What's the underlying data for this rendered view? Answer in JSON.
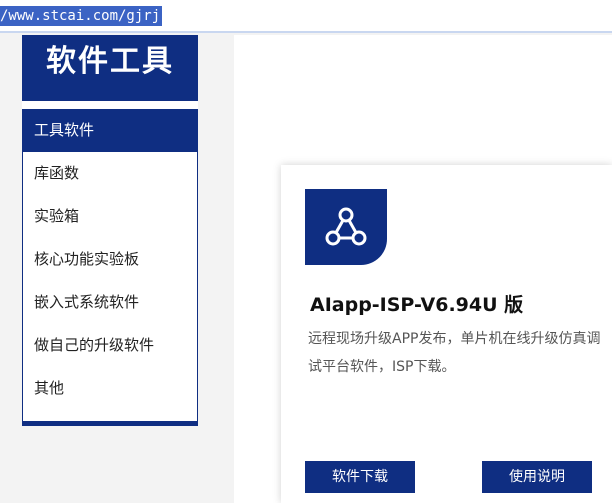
{
  "browser": {
    "url": "/www.stcai.com/gjrj"
  },
  "sidebar": {
    "title": "软件工具",
    "items": [
      {
        "label": "工具软件",
        "active": true
      },
      {
        "label": "库函数",
        "active": false
      },
      {
        "label": "实验箱",
        "active": false
      },
      {
        "label": "核心功能实验板",
        "active": false
      },
      {
        "label": "嵌入式系统软件",
        "active": false
      },
      {
        "label": "做自己的升级软件",
        "active": false
      },
      {
        "label": "其他",
        "active": false
      }
    ]
  },
  "card": {
    "icon": "share-network-icon",
    "name": "AIapp-ISP-V6.94U 版",
    "description": "远程现场升级APP发布，单片机在线升级仿真调试平台软件，ISP下载。",
    "download_label": "软件下载",
    "manual_label": "使用说明"
  },
  "colors": {
    "brand": "#0f2e82",
    "background": "#f3f3f3"
  }
}
